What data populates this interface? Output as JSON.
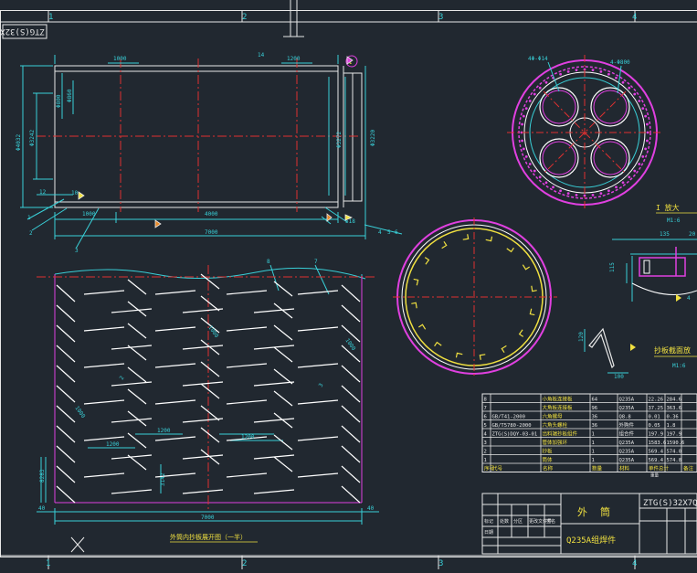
{
  "colors": {
    "background": "#212830",
    "frame": "#e8e8e8",
    "cyan": "#39d0d8",
    "red": "#e03030",
    "magenta": "#e040e0",
    "yellow": "#f0e040",
    "white": "#ffffff",
    "orange": "#e88a2a"
  },
  "grid": {
    "top": [
      "1",
      "2",
      "3",
      "4"
    ],
    "bottom": [
      "1",
      "2",
      "3",
      "4"
    ]
  },
  "drawing_code_rotated": "ZTG(S)32X7Q",
  "views": {
    "front": {
      "dims": {
        "top_1000": "1000",
        "top_1200": "1200",
        "top_14": "14",
        "left_800": "Φ800",
        "left_860": "Φ860",
        "left_3242": "Φ3242",
        "left_4032": "Φ4032",
        "left_12": "12",
        "left_10": "10",
        "bottom_1000": "1000",
        "bottom_4000": "4000",
        "bottom_7000": "7000",
        "right_3272": "Φ3272",
        "right_3220": "Φ3220",
        "right_518": "518"
      },
      "balloons": {
        "b1": "1",
        "b2": "2",
        "b3": "3",
        "b4": "4",
        "b5": "5",
        "b6": "6"
      },
      "section_label": "I"
    },
    "side_circle": {
      "label_4x614": "4Φ-Φ14",
      "label_4m800": "4-Φ800"
    },
    "detail_i": {
      "title": "I 放大",
      "scale": "M1:6",
      "d135": "135",
      "d20": "20",
      "d115": "115",
      "d4": "4"
    },
    "plate_section": {
      "title": "抄板截面放",
      "scale": "M1:6",
      "d120": "120",
      "d100": "100"
    },
    "development": {
      "dims": {
        "d1000a": "1000",
        "d1000b": "1000",
        "d1000c": "1000",
        "d1200a": "1200",
        "d1200b": "1200",
        "d1200c": "1200",
        "d2": "2",
        "d3": "3",
        "d8283": "8283",
        "d3142": "3142",
        "d40l": "40",
        "d40r": "40",
        "d7000": "7000",
        "b8": "8",
        "b7": "7"
      },
      "caption": "外筒内抄板展开图（一半）"
    }
  },
  "bom": {
    "rows": [
      {
        "no": "8",
        "code": "",
        "name": "小角板连接板",
        "qty": "64",
        "mat": "Q235A",
        "w1": "22.26",
        "w2": "284.6"
      },
      {
        "no": "7",
        "code": "",
        "name": "大角板连接板",
        "qty": "96",
        "mat": "Q235A",
        "w1": "37.25",
        "w2": "363.6"
      },
      {
        "no": "6",
        "code": "GB/T41-2000",
        "name": "六角螺母",
        "qty": "36",
        "mat": "Q8.8",
        "w1": "0.01",
        "w2": "0.36"
      },
      {
        "no": "5",
        "code": "GB/T5780-2000",
        "name": "六角头螺栓",
        "qty": "36",
        "mat": "外购件",
        "w1": "0.05",
        "w2": "1.8"
      },
      {
        "no": "4",
        "code": "ZTG(S)DQY-03-01",
        "name": "出料端抄板组件",
        "qty": "1",
        "mat": "组合件",
        "w1": "197.9",
        "w2": "197.9"
      },
      {
        "no": "3",
        "code": "",
        "name": "管体加强环",
        "qty": "1",
        "mat": "Q235A",
        "w1": "1583.6",
        "w2": "1590.6"
      },
      {
        "no": "2",
        "code": "",
        "name": "抄板",
        "qty": "1",
        "mat": "Q235A",
        "w1": "569.4",
        "w2": "574.0"
      },
      {
        "no": "1",
        "code": "",
        "name": "筒体",
        "qty": "1",
        "mat": "Q235A",
        "w1": "569.4",
        "w2": "574.8"
      }
    ],
    "header": {
      "no": "序号",
      "code": "代号",
      "name": "名称",
      "qty": "数量",
      "mat": "材料",
      "w": "单件总计",
      "note": "备注"
    },
    "weight_label": "重量"
  },
  "title_block": {
    "part_name": "外筒",
    "material": "Q235A组焊件",
    "code": "ZTG(S)32X7Q",
    "labels": {
      "l1": "标记",
      "l2": "处数",
      "l3": "分区",
      "l4": "更改文件号",
      "l5": "签名",
      "l6": "日期"
    }
  }
}
